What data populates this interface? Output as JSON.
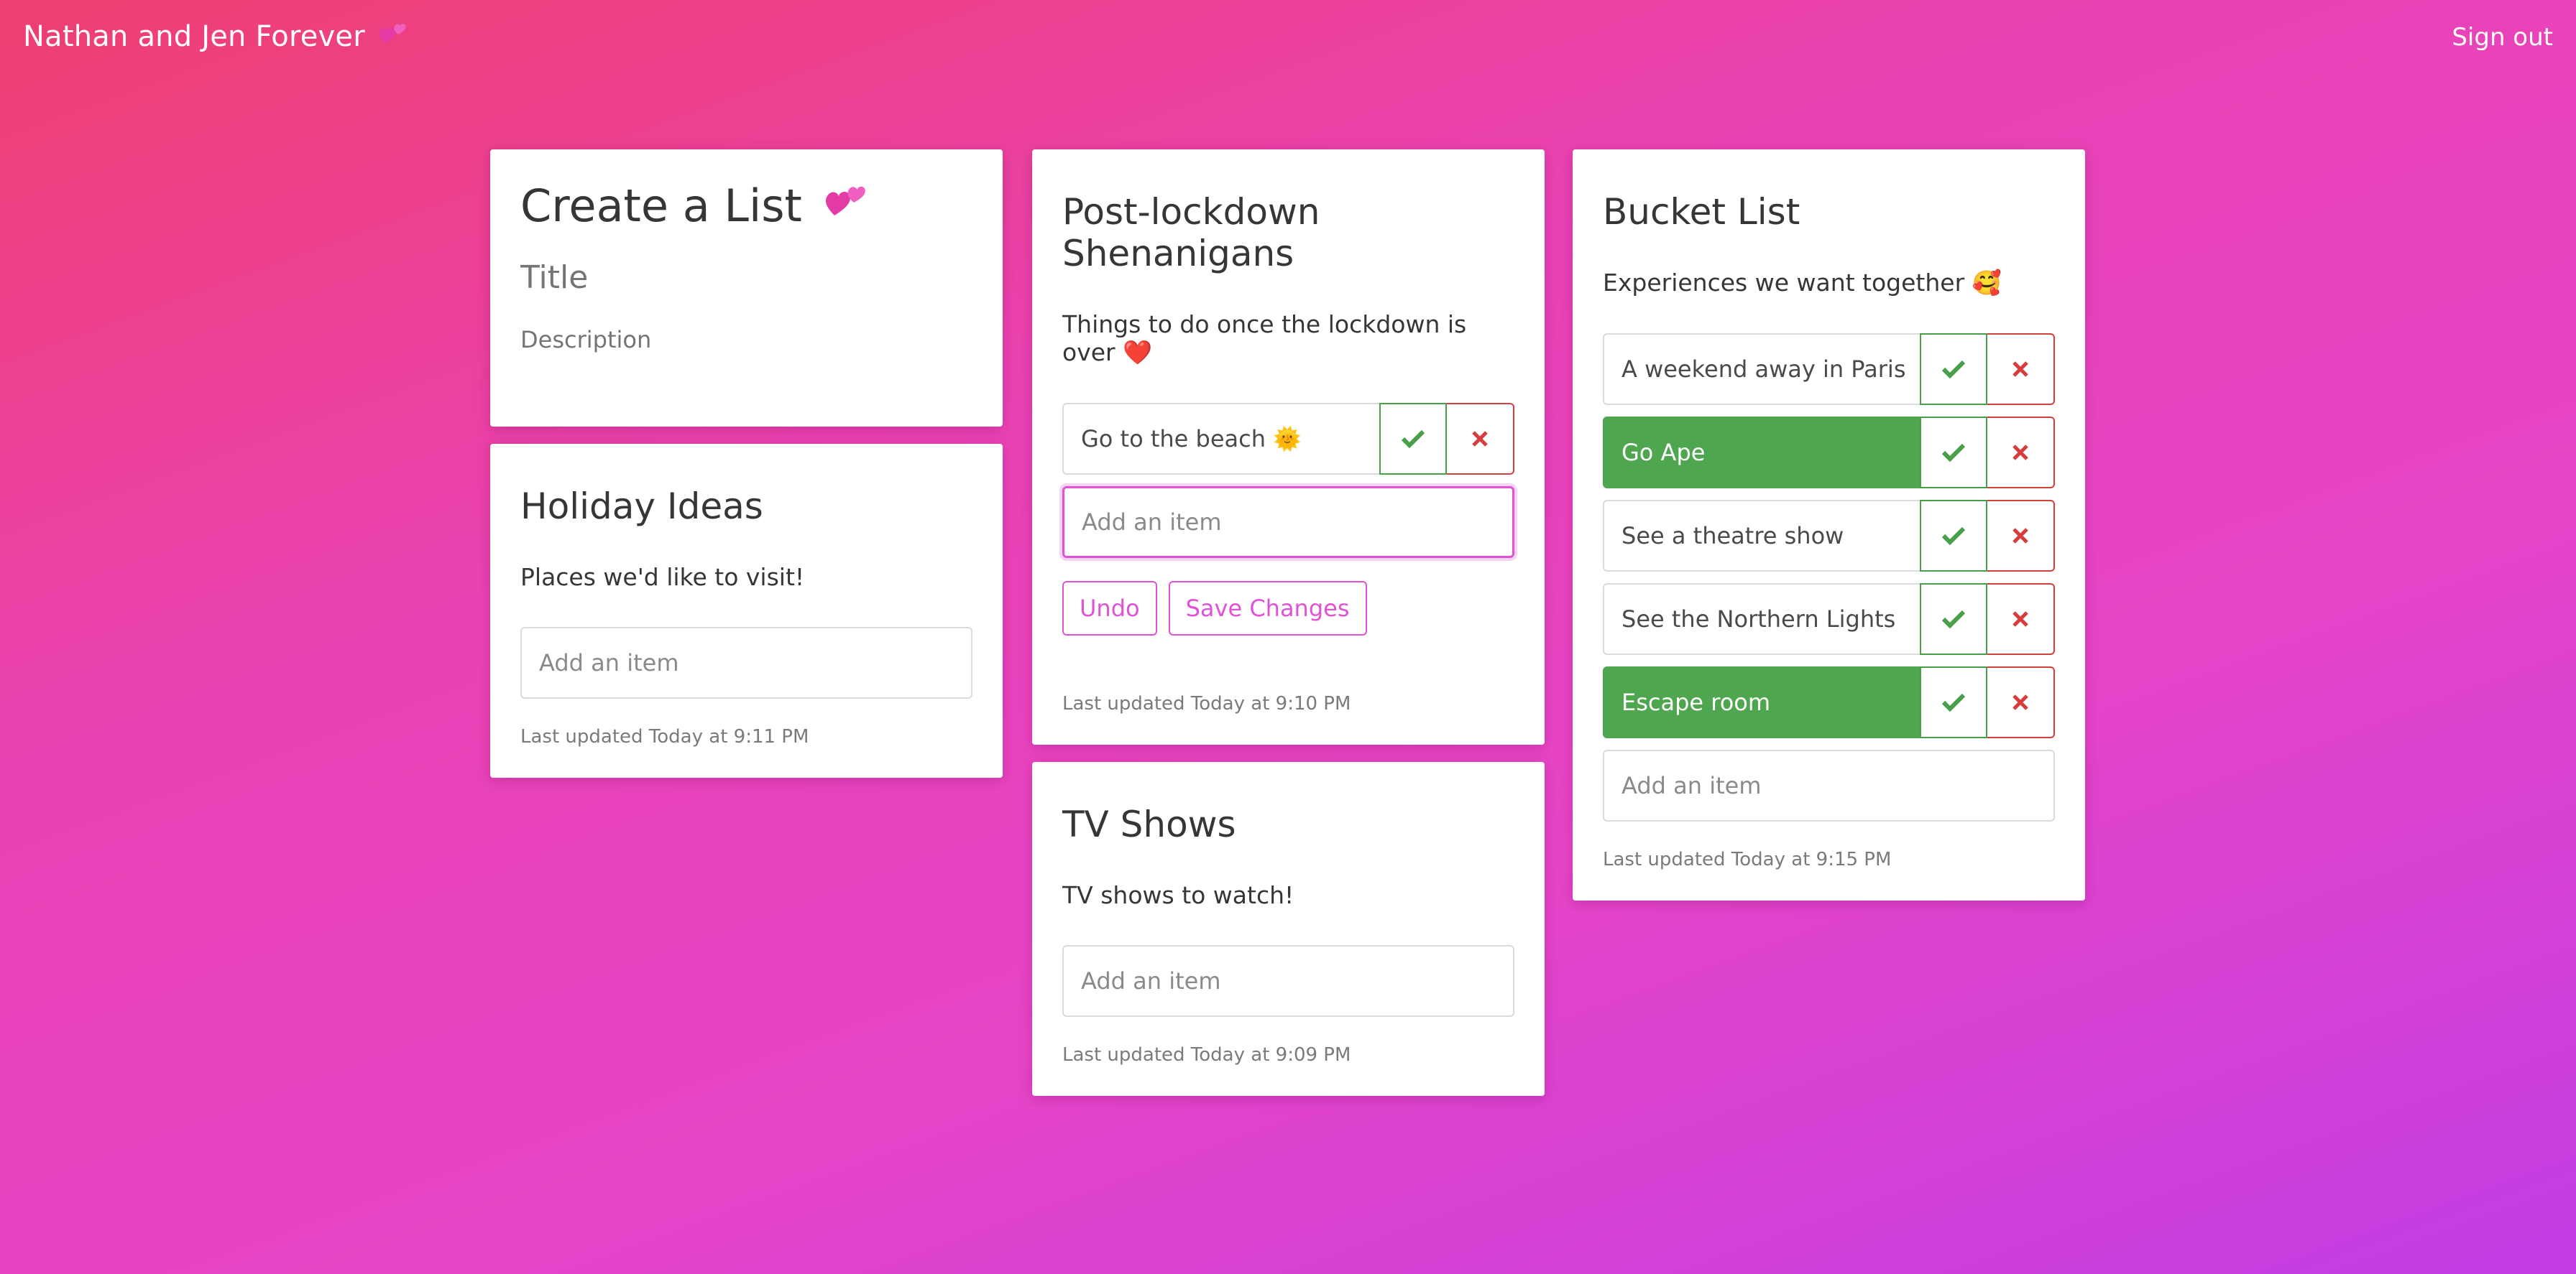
{
  "header": {
    "brand": "Nathan and Jen Forever",
    "brand_icon": "two-hearts-icon",
    "signout": "Sign out"
  },
  "create": {
    "title": "Create a List",
    "title_icon": "two-hearts-icon",
    "title_placeholder": "Title",
    "description_placeholder": "Description"
  },
  "holiday": {
    "title": "Holiday Ideas",
    "description": "Places we'd like to visit!",
    "add_placeholder": "Add an item",
    "updated": "Last updated Today at 9:11 PM"
  },
  "shenanigans": {
    "title": "Post-lockdown Shenanigans",
    "description": "Things to do once the lockdown is over ❤️",
    "items": [
      {
        "label": "Go to the beach 🌞",
        "done": false
      }
    ],
    "add_placeholder": "Add an item",
    "undo_label": "Undo",
    "save_label": "Save Changes",
    "updated": "Last updated Today at 9:10 PM"
  },
  "tvshows": {
    "title": "TV Shows",
    "description": "TV shows to watch!",
    "add_placeholder": "Add an item",
    "updated": "Last updated Today at 9:09 PM"
  },
  "bucket": {
    "title": "Bucket List",
    "description": "Experiences we want together 🥰",
    "items": [
      {
        "label": "A weekend away in Paris",
        "done": false
      },
      {
        "label": "Go Ape",
        "done": true
      },
      {
        "label": "See a theatre show",
        "done": false
      },
      {
        "label": "See the Northern Lights",
        "done": false
      },
      {
        "label": "Escape room",
        "done": true
      }
    ],
    "add_placeholder": "Add an item",
    "updated": "Last updated Today at 9:15 PM"
  },
  "colors": {
    "accent": "#e052d6",
    "check": "#48a048",
    "remove": "#d63d3d",
    "done_fill": "#4ea64e"
  }
}
